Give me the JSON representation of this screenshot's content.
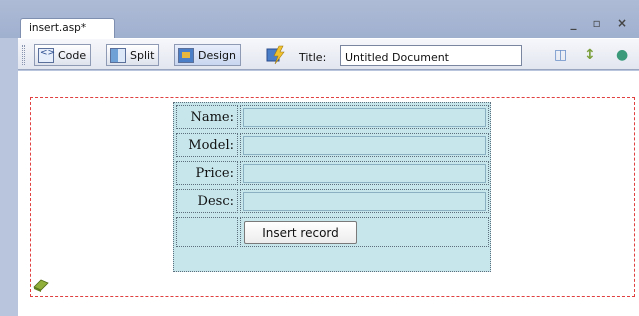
{
  "window": {
    "tab_title": "insert.asp*",
    "controls": "_ ▫ ×"
  },
  "toolbar": {
    "code_label": "Code",
    "split_label": "Split",
    "design_label": "Design",
    "title_label": "Title:",
    "title_value": "Untitled Document"
  },
  "form": {
    "rows": [
      {
        "label": "Name:"
      },
      {
        "label": "Model:"
      },
      {
        "label": "Price:"
      },
      {
        "label": "Desc:"
      }
    ],
    "submit_label": "Insert record"
  },
  "colors": {
    "form_bg": "#c6e6ec",
    "form_border": "#e04040",
    "chrome": "#b9c5dd"
  }
}
